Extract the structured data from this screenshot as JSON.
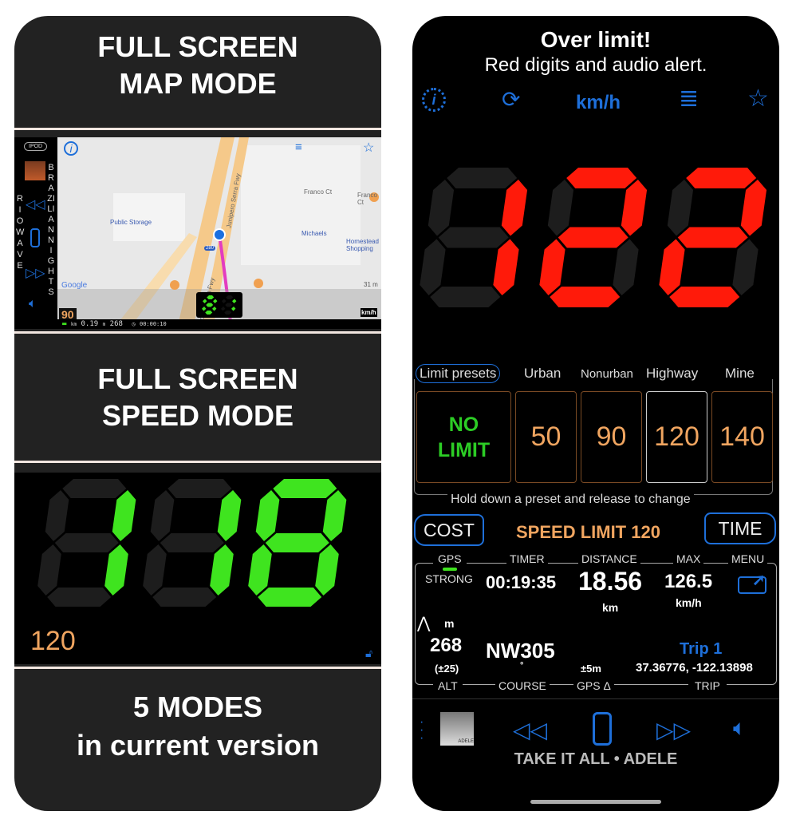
{
  "colors": {
    "accent": "#1e6fd9",
    "over": "#ff1a0a",
    "green": "#3fe41f",
    "orange": "#f0a560",
    "unlit": "#1d1d1d"
  },
  "left": {
    "title1": [
      "FULL SCREEN",
      "MAP MODE"
    ],
    "map": {
      "source_label": "IPOD",
      "track": "BRAZILIAN NIGHTS",
      "artist": "RIO WAVE",
      "places": [
        "Public Storage",
        "Michaels",
        "Homestead Shopping",
        "Franco Ct",
        "Franco Ct",
        "Junipero Serra Fwy",
        "Junipero Serra Fwy"
      ],
      "highway": "280",
      "scale": "31 m",
      "google": "Google",
      "speed": "81",
      "limit": "90",
      "unit": "km/h",
      "bar": {
        "distance_unit": "km",
        "distance": "0.19",
        "alt_unit": "m",
        "alt": "268",
        "timer": "00:00:10"
      }
    },
    "title2": [
      "FULL SCREEN",
      "SPEED MODE"
    ],
    "speed_mode": {
      "speed": "118",
      "limit": "120"
    },
    "title3": [
      "5 MODES",
      "in current version"
    ]
  },
  "right": {
    "headline": "Over limit!",
    "subline": "Red digits and audio alert.",
    "toolbar": {
      "unit": "km/h",
      "icons": [
        "info-icon",
        "refresh-icon",
        "menu-icon",
        "star-icon"
      ]
    },
    "speed": "122",
    "presets": {
      "labels": [
        "Limit presets",
        "Urban",
        "Nonurban",
        "Highway",
        "Mine"
      ],
      "no_limit": [
        "NO",
        "LIMIT"
      ],
      "values": [
        "50",
        "90",
        "120",
        "140"
      ],
      "selected": "120",
      "hint": "Hold down a preset and release to change"
    },
    "cost": "COST",
    "speed_limit": "SPEED LIMIT 120",
    "time": "TIME",
    "dash": {
      "gps_label": "GPS",
      "gps_value": "STRONG",
      "timer_label": "TIMER",
      "timer": "00:19:35",
      "distance_label": "DISTANCE",
      "distance": "18.56",
      "distance_unit": "km",
      "max_label": "MAX",
      "max": "126.5",
      "max_unit": "km/h",
      "menu_label": "MENU",
      "alt_unit": "m",
      "alt": "268",
      "alt_acc": "(±25)",
      "course": "NW305",
      "course_unit": "°",
      "gps_acc": "±5m",
      "trip_name": "Trip 1",
      "coords": "37.36776, -122.13898",
      "alt_label": "ALT",
      "course_label": "COURSE",
      "gps_delta_label": "GPS Δ",
      "trip_label": "TRIP"
    },
    "player": {
      "song": "TAKE IT ALL • ADELE",
      "album_label": "ADELE"
    }
  }
}
